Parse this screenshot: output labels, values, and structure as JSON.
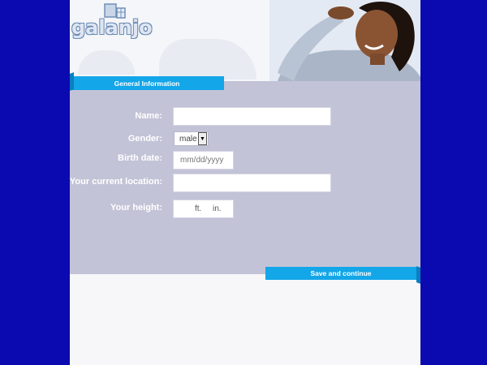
{
  "brand": {
    "logo_text": "galanjo"
  },
  "colors": {
    "background": "#0a0ab0",
    "accent": "#13a6e8",
    "panel": "#c3c3d7"
  },
  "section_tab": {
    "label": "General Information"
  },
  "form": {
    "name": {
      "label": "Name:",
      "value": ""
    },
    "gender": {
      "label": "Gender:",
      "selected": "male"
    },
    "birth_date": {
      "label": "Birth date:",
      "placeholder": "mm/dd/yyyy"
    },
    "location": {
      "label": "Your current location:",
      "value": ""
    },
    "height": {
      "label": "Your height:",
      "feet_unit": "ft.",
      "inches_unit": "in."
    }
  },
  "actions": {
    "save_label": "Save and continue"
  },
  "icons": {
    "logo_mark": "window-icon",
    "select_arrow": "chevron-down-icon"
  }
}
